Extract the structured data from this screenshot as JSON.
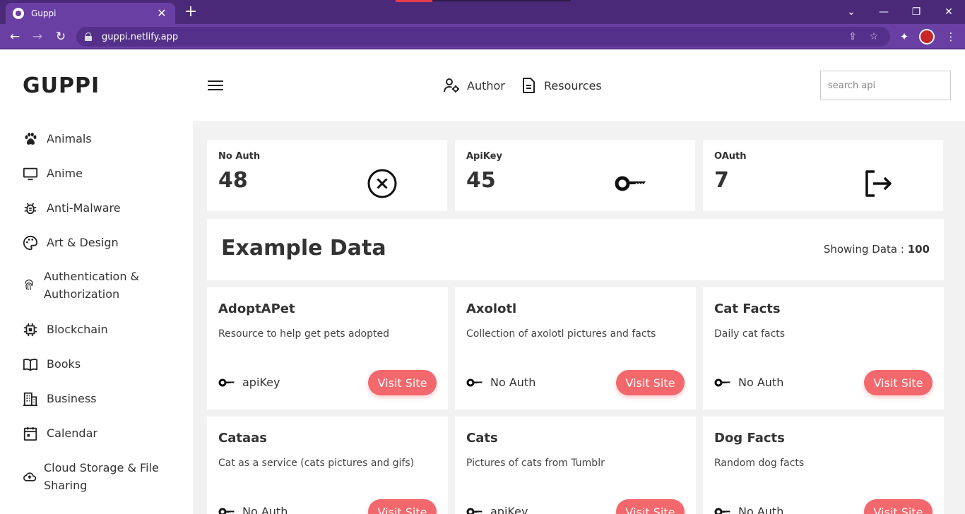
{
  "browser": {
    "tab_title": "Guppi",
    "tab_close": "✕",
    "new_tab": "+",
    "url": "guppi.netlify.app",
    "window_controls": {
      "dropdown": "⌄",
      "minimize": "—",
      "restore": "❐",
      "close": "✕"
    },
    "nav": {
      "back": "←",
      "forward": "→",
      "reload": "↻"
    }
  },
  "app": {
    "brand": "GUPPI",
    "topnav": [
      {
        "label": "Author",
        "icon": "user-gear-icon"
      },
      {
        "label": "Resources",
        "icon": "document-icon"
      }
    ],
    "search_placeholder": "search api",
    "sidebar": [
      {
        "label": "Animals",
        "icon": "paw-icon"
      },
      {
        "label": "Anime",
        "icon": "monitor-icon"
      },
      {
        "label": "Anti-Malware",
        "icon": "bug-icon"
      },
      {
        "label": "Art & Design",
        "icon": "palette-icon"
      },
      {
        "label": "Authentication &",
        "label2": "Authorization",
        "icon": "fingerprint-icon"
      },
      {
        "label": "Blockchain",
        "icon": "chip-icon"
      },
      {
        "label": "Books",
        "icon": "book-icon"
      },
      {
        "label": "Business",
        "icon": "building-icon"
      },
      {
        "label": "Calendar",
        "icon": "calendar-icon"
      },
      {
        "label": "Cloud Storage & File",
        "label2": "Sharing",
        "icon": "cloud-upload-icon"
      }
    ],
    "stats": [
      {
        "label": "No Auth",
        "value": "48",
        "icon": "circle-x-icon"
      },
      {
        "label": "ApiKey",
        "value": "45",
        "icon": "key-icon"
      },
      {
        "label": "OAuth",
        "value": "7",
        "icon": "logout-icon"
      }
    ],
    "example": {
      "title": "Example Data",
      "count_label": "Showing Data : ",
      "count_value": "100"
    },
    "visit_label": "Visit Site",
    "cards": [
      {
        "title": "AdoptAPet",
        "desc": "Resource to help get pets adopted",
        "auth": "apiKey"
      },
      {
        "title": "Axolotl",
        "desc": "Collection of axolotl pictures and facts",
        "auth": "No Auth"
      },
      {
        "title": "Cat Facts",
        "desc": "Daily cat facts",
        "auth": "No Auth"
      },
      {
        "title": "Cataas",
        "desc": "Cat as a service (cats pictures and gifs)",
        "auth": "No Auth"
      },
      {
        "title": "Cats",
        "desc": "Pictures of cats from Tumblr",
        "auth": "apiKey"
      },
      {
        "title": "Dog Facts",
        "desc": "Random dog facts",
        "auth": "No Auth"
      }
    ],
    "colors": {
      "accent": "#f2686c",
      "browser_frame": "#6a3fa3",
      "main_bg": "#f2f2f2"
    }
  }
}
